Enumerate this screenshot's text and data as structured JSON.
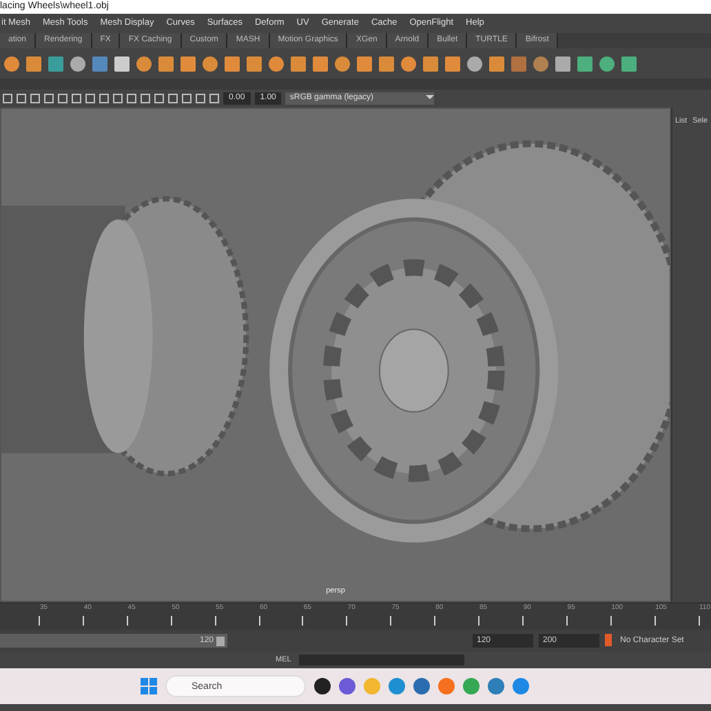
{
  "window": {
    "title": "lacing Wheels\\wheel1.obj"
  },
  "menu": [
    "it Mesh",
    "Mesh Tools",
    "Mesh Display",
    "Curves",
    "Surfaces",
    "Deform",
    "UV",
    "Generate",
    "Cache",
    "OpenFlight",
    "Help"
  ],
  "shelf_tabs": [
    {
      "label": "ation",
      "selected": false
    },
    {
      "label": "Rendering",
      "selected": false
    },
    {
      "label": "FX",
      "selected": false
    },
    {
      "label": "FX Caching",
      "selected": false
    },
    {
      "label": "Custom",
      "selected": false
    },
    {
      "label": "MASH",
      "selected": false
    },
    {
      "label": "Motion Graphics",
      "selected": false
    },
    {
      "label": "XGen",
      "selected": false
    },
    {
      "label": "Arnold",
      "selected": false
    },
    {
      "label": "Bullet",
      "selected": false
    },
    {
      "label": "TURTLE",
      "selected": false
    },
    {
      "label": "Bifrost",
      "selected": false
    }
  ],
  "viewport_toolbar": {
    "exposure": "0.00",
    "gamma": "1.00",
    "color_space": "sRGB gamma (legacy)"
  },
  "side_panel": {
    "tabs": [
      "List",
      "Sele"
    ]
  },
  "viewport": {
    "camera": "persp"
  },
  "timeline": {
    "ticks": [
      "35",
      "40",
      "45",
      "50",
      "55",
      "60",
      "65",
      "70",
      "75",
      "80",
      "85",
      "90",
      "95",
      "100",
      "105",
      "110"
    ]
  },
  "range": {
    "slider_end": "120",
    "level": 1,
    "playback_start": "120",
    "playback_end": "200",
    "character_set": "No Character Set"
  },
  "command_line": {
    "language": "MEL"
  },
  "taskbar": {
    "search": {
      "placeholder": "Search"
    }
  }
}
